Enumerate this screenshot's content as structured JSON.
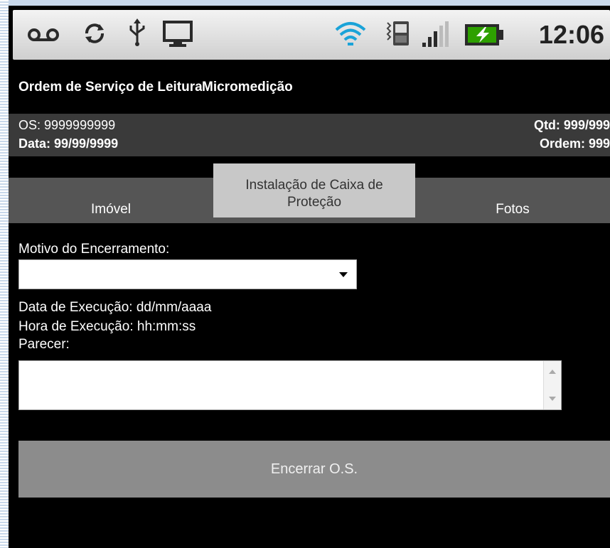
{
  "status_bar": {
    "time": "12:06",
    "icons": [
      "voicemail-icon",
      "sync-icon",
      "usb-icon",
      "monitor-icon",
      "wifi-icon",
      "vibrate-icon",
      "signal-icon",
      "battery-charging-icon"
    ],
    "battery_color": "#2ea000"
  },
  "header": {
    "title_part1": "Ordem de Serviço de Leitura",
    "title_part2": "Micromedição"
  },
  "info": {
    "os": "OS: 9999999999",
    "date": "Data: 99/99/9999",
    "qtd": "Qtd: 999/999",
    "ordem": "Ordem: 999"
  },
  "tabs": [
    {
      "label": "Imóvel",
      "active": false
    },
    {
      "label": "Instalação de Caixa de Proteção",
      "active": true
    },
    {
      "label": "Fotos",
      "active": false
    }
  ],
  "form": {
    "motivo_label": "Motivo do Encerramento:",
    "motivo_value": "",
    "data_execucao": "Data de Execução: dd/mm/aaaa",
    "hora_execucao": "Hora de Execução: hh:mm:ss",
    "parecer_label": "Parecer:",
    "parecer_value": ""
  },
  "actions": {
    "encerrar_label": "Encerrar O.S."
  }
}
